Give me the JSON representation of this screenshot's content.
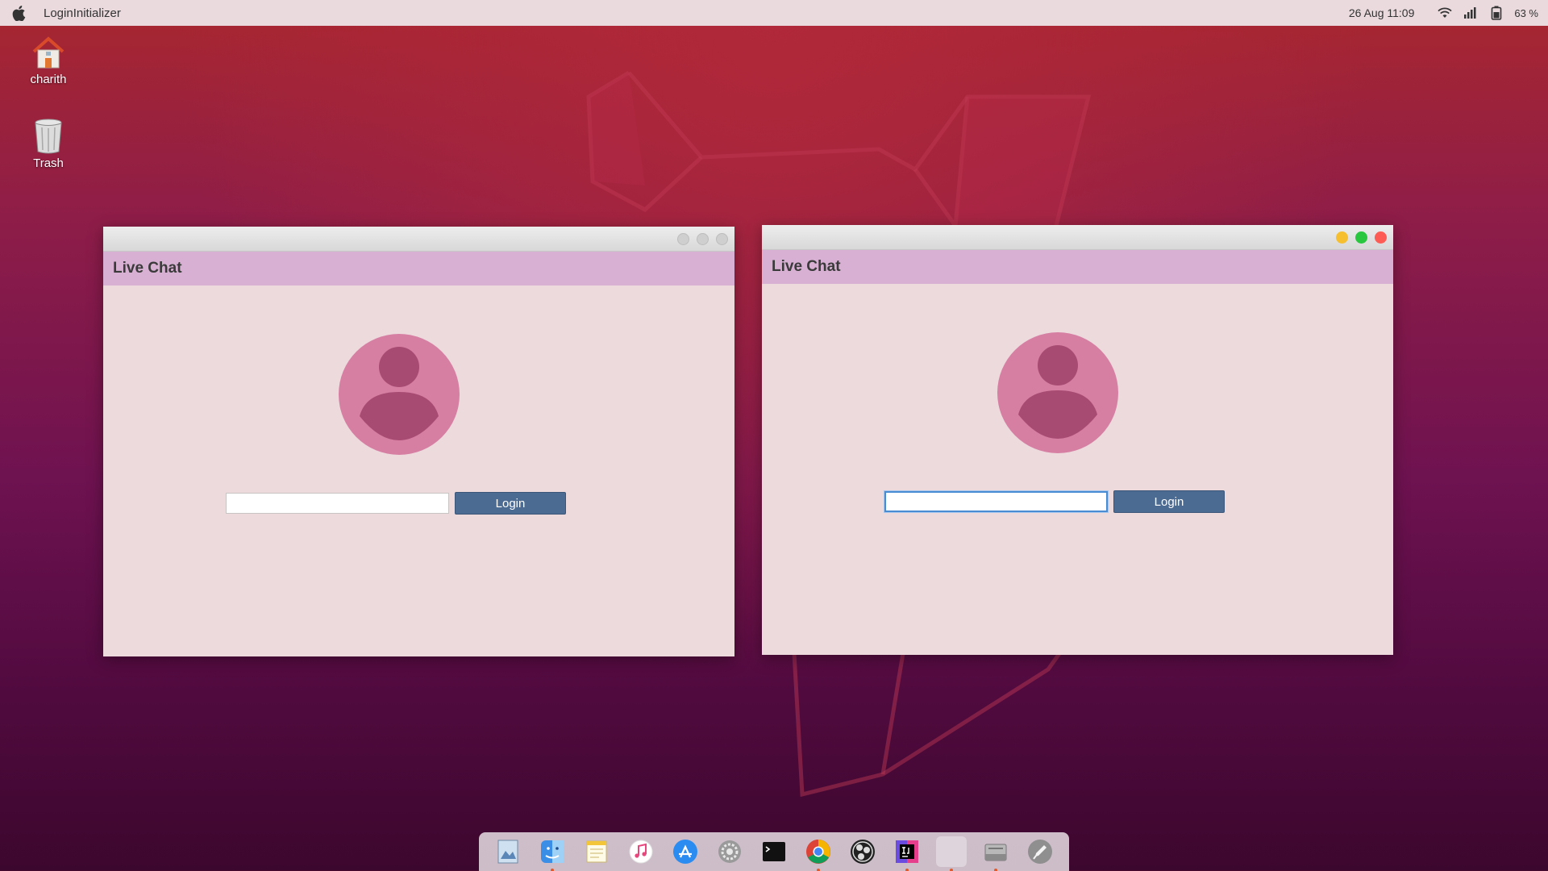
{
  "topbar": {
    "app_name": "LoginInitializer",
    "datetime": "26 Aug  11:09",
    "battery": "63 %"
  },
  "desktop": {
    "icons": [
      {
        "label": "charith",
        "icon": "home-folder-icon"
      },
      {
        "label": "Trash",
        "icon": "trash-icon"
      }
    ]
  },
  "windows": [
    {
      "header_title": "Live Chat",
      "name_value": "",
      "login_label": "Login",
      "state": "inactive"
    },
    {
      "header_title": "Live Chat",
      "name_value": "",
      "login_label": "Login",
      "state": "active"
    }
  ],
  "dock": {
    "items": [
      {
        "name": "preview-icon",
        "running": false
      },
      {
        "name": "finder-icon",
        "running": true
      },
      {
        "name": "notes-icon",
        "running": false
      },
      {
        "name": "music-icon",
        "running": false
      },
      {
        "name": "app-store-icon",
        "running": false
      },
      {
        "name": "settings-icon",
        "running": false
      },
      {
        "name": "terminal-icon",
        "running": false
      },
      {
        "name": "chrome-icon",
        "running": true
      },
      {
        "name": "obs-icon",
        "running": false
      },
      {
        "name": "intellij-icon",
        "running": true
      },
      {
        "name": "blank-app-icon",
        "running": true
      },
      {
        "name": "drive-icon",
        "running": true
      },
      {
        "name": "launchpad-icon",
        "running": false
      }
    ]
  },
  "colors": {
    "window_bg": "#ecdadd",
    "header_bg": "#d8b0d3",
    "button_bg": "#4b6b92",
    "avatar_bg": "#d67fa3",
    "avatar_fg": "#a84b72"
  }
}
